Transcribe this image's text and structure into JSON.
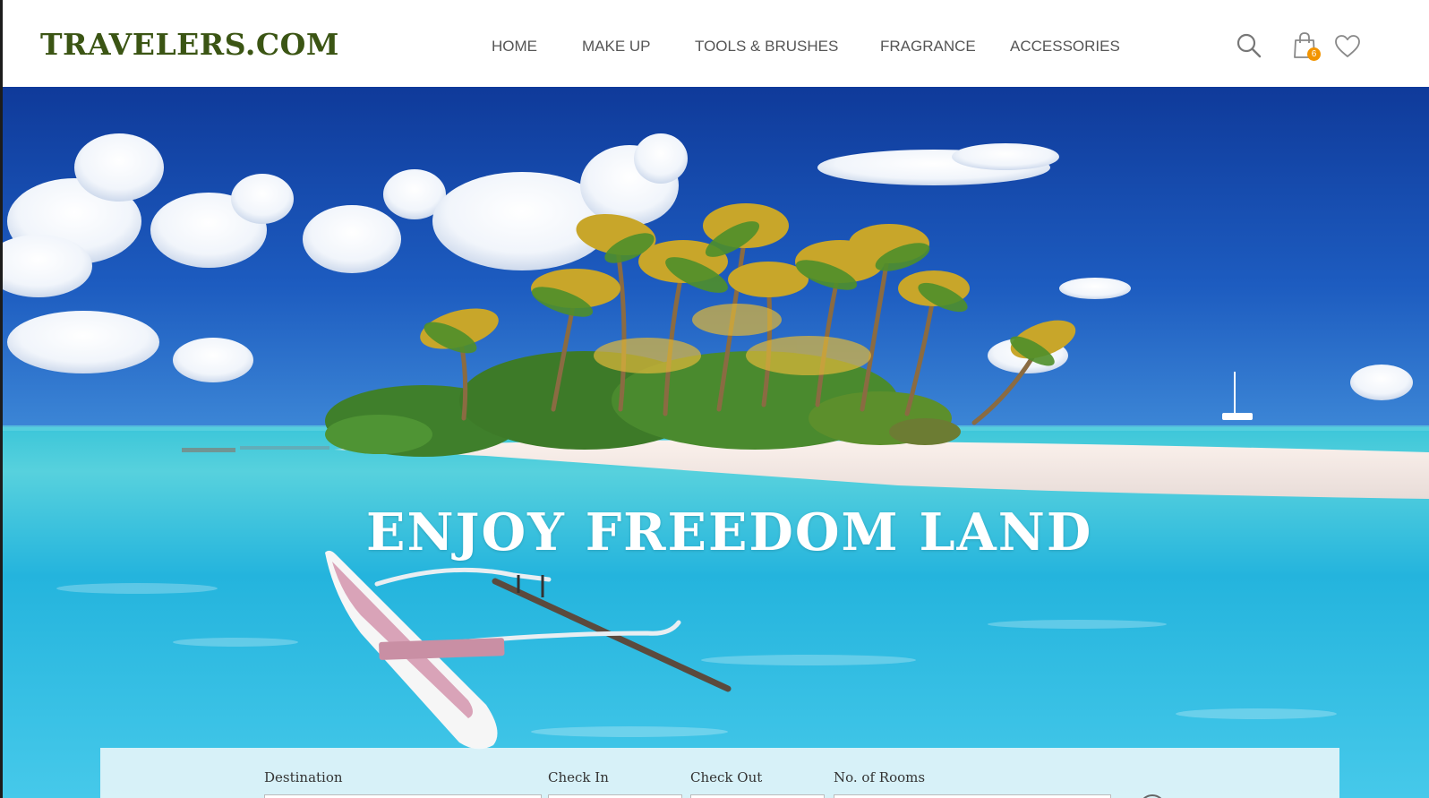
{
  "site": {
    "logo": "TRAVELERS.COM"
  },
  "nav": {
    "items": [
      {
        "label": "HOME"
      },
      {
        "label": "MAKE UP"
      },
      {
        "label": "TOOLS & BRUSHES"
      },
      {
        "label": "FRAGRANCE"
      },
      {
        "label": "ACCESSORIES"
      }
    ]
  },
  "header_icons": {
    "search": "search-icon",
    "cart": "shopping-bag-icon",
    "wishlist": "heart-icon",
    "cart_count": "6",
    "badge_color": "#f29400"
  },
  "hero": {
    "title": "ENJOY FREEDOM LAND",
    "image": "tropical-island-with-palm-trees-and-outrigger-canoe"
  },
  "booking": {
    "destination_label": "Destination",
    "checkin_label": "Check In",
    "checkout_label": "Check Out",
    "rooms_label": "No. of Rooms"
  },
  "colors": {
    "logo": "#3b5514",
    "nav_text": "#555555",
    "hero_title": "#ffffff"
  }
}
